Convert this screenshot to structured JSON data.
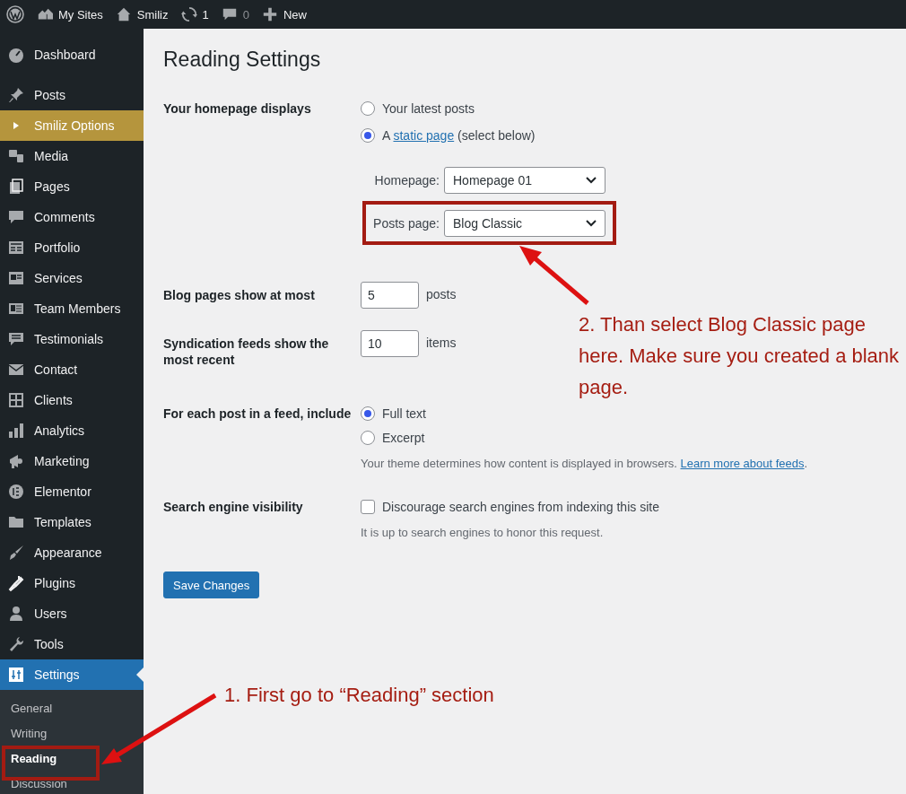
{
  "admin_bar": {
    "items": [
      {
        "kind": "sites",
        "label": "My Sites"
      },
      {
        "kind": "site",
        "label": "Smiliz"
      },
      {
        "kind": "updates",
        "label": "1"
      },
      {
        "kind": "comments",
        "label": "0"
      },
      {
        "kind": "new",
        "label": "New"
      }
    ]
  },
  "sidebar": {
    "items": [
      {
        "label": "Dashboard",
        "kind": "menu",
        "selected": false
      },
      {
        "label": "Posts",
        "kind": "menu",
        "selected": false
      },
      {
        "label": "Smiliz Options",
        "kind": "plugin",
        "selected": false
      },
      {
        "label": "Media",
        "kind": "menu",
        "selected": false
      },
      {
        "label": "Pages",
        "kind": "menu",
        "selected": false
      },
      {
        "label": "Comments",
        "kind": "menu",
        "selected": false
      },
      {
        "label": "Portfolio",
        "kind": "menu",
        "selected": false
      },
      {
        "label": "Services",
        "kind": "menu",
        "selected": false
      },
      {
        "label": "Team Members",
        "kind": "menu",
        "selected": false
      },
      {
        "label": "Testimonials",
        "kind": "menu",
        "selected": false
      },
      {
        "label": "Contact",
        "kind": "menu",
        "selected": false
      },
      {
        "label": "Clients",
        "kind": "menu",
        "selected": false
      },
      {
        "label": "Analytics",
        "kind": "menu",
        "selected": false
      },
      {
        "label": "Marketing",
        "kind": "menu",
        "selected": false
      },
      {
        "label": "Elementor",
        "kind": "menu",
        "selected": false
      },
      {
        "label": "Templates",
        "kind": "menu",
        "selected": false
      },
      {
        "label": "Appearance",
        "kind": "menu",
        "selected": false
      },
      {
        "label": "Plugins",
        "kind": "menu",
        "selected": false
      },
      {
        "label": "Users",
        "kind": "menu",
        "selected": false
      },
      {
        "label": "Tools",
        "kind": "menu",
        "selected": false
      },
      {
        "label": "Settings",
        "kind": "menu",
        "selected": true,
        "children": [
          {
            "label": "General",
            "selected": false
          },
          {
            "label": "Writing",
            "selected": false
          },
          {
            "label": "Reading",
            "selected": true
          },
          {
            "label": "Discussion",
            "selected": false
          }
        ]
      }
    ]
  },
  "page": {
    "title": "Reading Settings",
    "homepage_displays": {
      "label": "Your homepage displays",
      "options": [
        {
          "label": "Your latest posts",
          "selected": false
        },
        {
          "label": "A",
          "link": "static page",
          "after_link": "(select below)",
          "selected": true
        }
      ],
      "selects": [
        {
          "label": "Homepage:",
          "value": "Homepage 01"
        },
        {
          "label": "Posts page:",
          "value": "Blog Classic"
        }
      ]
    },
    "blog_pages": {
      "label": "Blog pages show at most",
      "value": "5",
      "unit": "posts"
    },
    "syndication": {
      "label": "Syndication feeds show the most recent",
      "value": "10",
      "unit": "items"
    },
    "feed_content": {
      "label": "For each post in a feed, include",
      "options": [
        {
          "label": "Full text",
          "selected": true
        },
        {
          "label": "Excerpt",
          "selected": false
        }
      ],
      "description": "Your theme determines how content is displayed in browsers.",
      "link": "Learn more about feeds",
      "after_link": "."
    },
    "search_visibility": {
      "label": "Search engine visibility",
      "checkbox": {
        "label": "Discourage search engines from indexing this site",
        "checked": false
      },
      "description": "It is up to search engines to honor this request."
    },
    "save_button": "Save Changes"
  },
  "annotations": [
    {
      "text": "2. Than select Blog Classic page here. Make sure you created a blank page."
    },
    {
      "text": "1. First go to “Reading” section"
    }
  ]
}
